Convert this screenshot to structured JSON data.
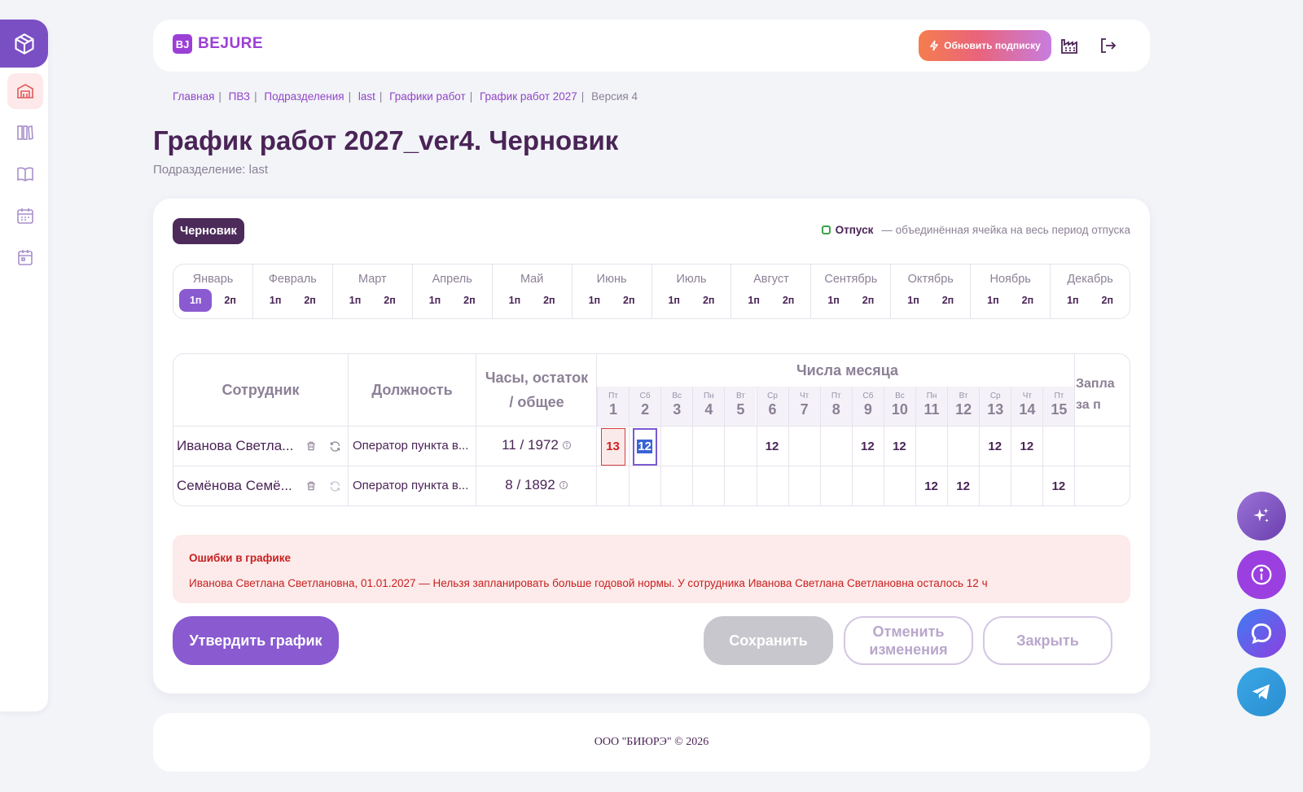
{
  "header": {
    "brand_mark": "BJ",
    "brand_name": "BEJURE",
    "upgrade_label": "Обновить подписку"
  },
  "breadcrumbs": [
    "Главная",
    "ПВЗ",
    "Подразделения",
    "last",
    "Графики работ",
    "График работ 2027",
    "Версия 4"
  ],
  "page": {
    "title": "График работ 2027_ver4. Черновик",
    "subtitle": "Подразделение: last",
    "status_badge": "Черновик"
  },
  "legend": {
    "label": "Отпуск",
    "description": "— объединённая ячейка на весь период отпуска",
    "color": "#3aa34c"
  },
  "months": [
    {
      "name": "Январь",
      "h1": "1п",
      "h2": "2п",
      "active": "h1"
    },
    {
      "name": "Февраль",
      "h1": "1п",
      "h2": "2п"
    },
    {
      "name": "Март",
      "h1": "1п",
      "h2": "2п"
    },
    {
      "name": "Апрель",
      "h1": "1п",
      "h2": "2п"
    },
    {
      "name": "Май",
      "h1": "1п",
      "h2": "2п"
    },
    {
      "name": "Июнь",
      "h1": "1п",
      "h2": "2п"
    },
    {
      "name": "Июль",
      "h1": "1п",
      "h2": "2п"
    },
    {
      "name": "Август",
      "h1": "1п",
      "h2": "2п"
    },
    {
      "name": "Сентябрь",
      "h1": "1п",
      "h2": "2п"
    },
    {
      "name": "Октябрь",
      "h1": "1п",
      "h2": "2п"
    },
    {
      "name": "Ноябрь",
      "h1": "1п",
      "h2": "2п"
    },
    {
      "name": "Декабрь",
      "h1": "1п",
      "h2": "2п"
    }
  ],
  "table": {
    "col_employee": "Сотрудник",
    "col_position": "Должность",
    "col_hours": "Часы, остаток / общее",
    "days_header": "Числа месяца",
    "col_planned_partial": "Запла\nза п",
    "days": [
      {
        "wd": "Пт",
        "n": "1"
      },
      {
        "wd": "Сб",
        "n": "2"
      },
      {
        "wd": "Вс",
        "n": "3"
      },
      {
        "wd": "Пн",
        "n": "4"
      },
      {
        "wd": "Вт",
        "n": "5"
      },
      {
        "wd": "Ср",
        "n": "6"
      },
      {
        "wd": "Чт",
        "n": "7"
      },
      {
        "wd": "Пт",
        "n": "8"
      },
      {
        "wd": "Сб",
        "n": "9"
      },
      {
        "wd": "Вс",
        "n": "10"
      },
      {
        "wd": "Пн",
        "n": "11"
      },
      {
        "wd": "Вт",
        "n": "12"
      },
      {
        "wd": "Ср",
        "n": "13"
      },
      {
        "wd": "Чт",
        "n": "14"
      },
      {
        "wd": "Пт",
        "n": "15"
      }
    ],
    "rows": [
      {
        "employee": "Иванова Светла...",
        "position": "Оператор пункта в...",
        "hours": "11 / 1972",
        "cells": [
          "13",
          "12",
          "",
          "",
          "",
          "12",
          "",
          "",
          "12",
          "12",
          "",
          "",
          "12",
          "12",
          ""
        ],
        "error_day": 1,
        "selected_day": 2
      },
      {
        "employee": "Семёнова Семё...",
        "position": "Оператор пункта в...",
        "hours": "8 / 1892",
        "cells": [
          "",
          "",
          "",
          "",
          "",
          "",
          "",
          "",
          "",
          "",
          "12",
          "12",
          "",
          "",
          "12"
        ]
      }
    ]
  },
  "errors": {
    "title": "Ошибки в графике",
    "message": "Иванова Светлана Светлановна, 01.01.2027 — Нельзя запланировать больше годовой нормы. У сотрудника Иванова Светлана Светлановна осталось 12 ч"
  },
  "actions": {
    "approve": "Утвердить график",
    "save": "Сохранить",
    "revert": "Отменить изменения",
    "close": "Закрыть"
  },
  "footer": {
    "text": "ООО \"БИЮРЭ\" © 2026"
  },
  "colors": {
    "accent": "#8a5ad0",
    "brand": "#9b3fd6",
    "error": "#c81f1f"
  }
}
